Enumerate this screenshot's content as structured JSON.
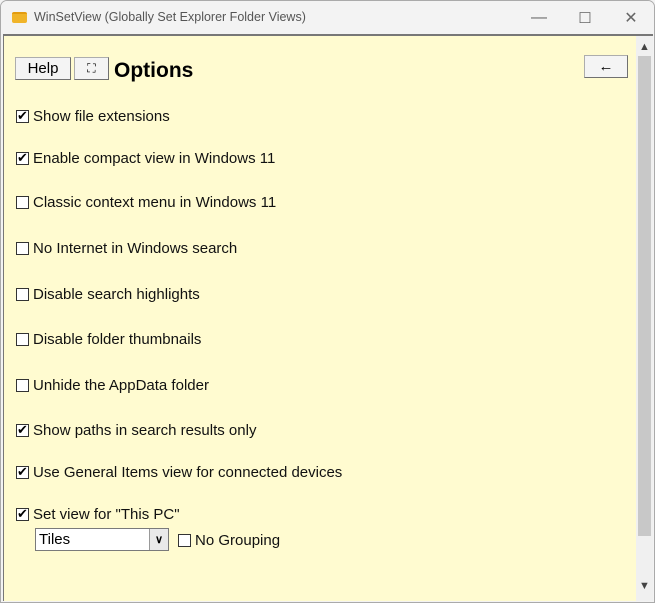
{
  "window": {
    "title": "WinSetView (Globally Set Explorer Folder Views)",
    "minimize_glyph": "—",
    "maximize_glyph": "☐",
    "close_glyph": "✕"
  },
  "toolbar": {
    "help_label": "Help",
    "fullscreen_glyph": "⛶",
    "back_glyph": "←",
    "heading": "Options"
  },
  "options": [
    {
      "label": "Show file extensions",
      "checked": true
    },
    {
      "label": "Enable compact view in Windows 11",
      "checked": true
    },
    {
      "label": "Classic context menu in Windows 11",
      "checked": false
    },
    {
      "label": "No Internet in Windows search",
      "checked": false
    },
    {
      "label": "Disable search highlights",
      "checked": false
    },
    {
      "label": "Disable folder thumbnails",
      "checked": false
    },
    {
      "label": "Unhide the AppData folder",
      "checked": false
    },
    {
      "label": "Show paths in search results only",
      "checked": true
    },
    {
      "label": "Use General Items view for connected devices",
      "checked": true
    },
    {
      "label": "Set view for \"This PC\"",
      "checked": true
    }
  ],
  "this_pc": {
    "view_selected": "Tiles",
    "no_grouping_label": "No Grouping",
    "no_grouping_checked": false
  },
  "scrollbar": {
    "up_glyph": "︿",
    "down_glyph": "﹀"
  }
}
